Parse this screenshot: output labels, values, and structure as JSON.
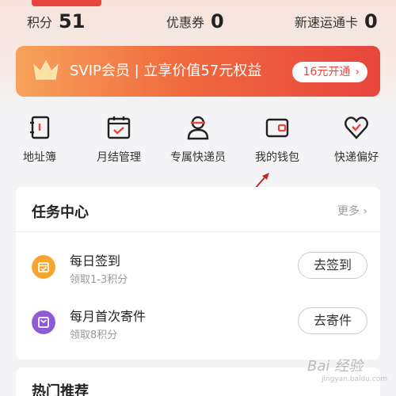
{
  "stats": {
    "points_label": "积分",
    "points_value": "51",
    "coupons_label": "优惠券",
    "coupons_value": "0",
    "card_label": "新速运通卡",
    "card_value": "0"
  },
  "svip": {
    "text": "SVIP会员 | 立享价值57元权益",
    "button_label": "16元开通",
    "chevron": "›"
  },
  "quick_actions": [
    {
      "label": "地址簿",
      "icon": "address-book-icon"
    },
    {
      "label": "月结管理",
      "icon": "calendar-check-icon"
    },
    {
      "label": "专属快递员",
      "icon": "courier-icon"
    },
    {
      "label": "我的钱包",
      "icon": "wallet-icon"
    },
    {
      "label": "快递偏好",
      "icon": "heart-check-icon"
    }
  ],
  "tasks": {
    "title": "任务中心",
    "more_label": "更多 ›",
    "items": [
      {
        "name": "每日签到",
        "desc": "领取1-3积分",
        "button": "去签到",
        "icon": "checkin-icon",
        "color": "#f7a52f"
      },
      {
        "name": "每月首次寄件",
        "desc": "领取8积分",
        "button": "去寄件",
        "icon": "package-icon",
        "color": "#8e5ad8"
      }
    ]
  },
  "hot": {
    "title": "热门推荐"
  },
  "watermark": {
    "main": "Bai 经验",
    "sub": "jingyan.baidu.com"
  },
  "colors": {
    "accent": "#e8453c",
    "orange": "#f7a25a"
  }
}
